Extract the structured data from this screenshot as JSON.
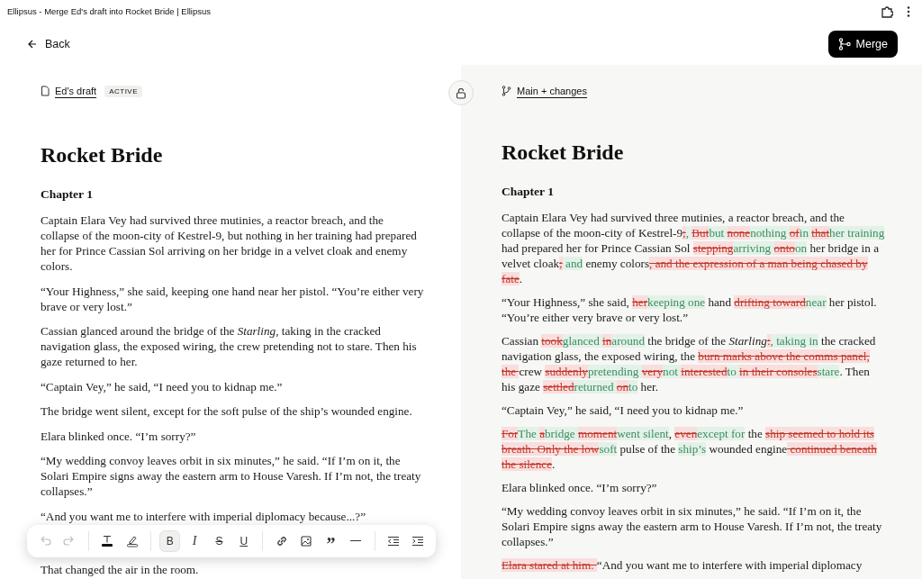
{
  "window": {
    "title": "Ellipsus - Merge Ed's draft into Rocket Bride | Ellipsus"
  },
  "header": {
    "back": "Back",
    "merge": "Merge"
  },
  "left_pane": {
    "doc_link": "Ed's draft",
    "badge": "ACTIVE",
    "title": "Rocket Bride",
    "chapter": "Chapter 1",
    "paragraphs": [
      "Captain Elara Vey had survived three mutinies, a reactor breach, and the collapse of the moon-city of Kestrel-9, but nothing in her training had prepared her for Prince Cassian Sol arriving on her bridge in a velvet cloak and enemy colors.",
      "“Your Highness,” she said, keeping one hand near her pistol. “You’re either very brave or very lost.”",
      "Cassian glanced around the bridge of the *Starling*, taking in the cracked navigation glass, the exposed wiring, the crew pretending not to stare. Then his gaze returned to her.",
      "“Captain Vey,” he said, “I need you to kidnap me.”",
      "The bridge went silent, except for the soft pulse of the ship’s wounded engine.",
      "Elara blinked once. “I’m sorry?”",
      "“My wedding convoy leaves orbit in six minutes,” he said. “If I’m on it, the Solari Empire signs away the eastern arm to House Varesh. If I’m not, the treaty collapses.”",
      "“And you want me to interfere with imperial diplomacy because...?”",
      "That changed the air in the room."
    ]
  },
  "right_pane": {
    "branch_link": "Main + changes",
    "title": "Rocket Bride",
    "chapter": "Chapter 1",
    "paragraphs": [
      [
        {
          "kind": "same",
          "text": "Captain Elara Vey had survived three mutinies, a reactor breach, and the collapse of the moon-city of Kestrel-9"
        },
        {
          "kind": "deleted",
          "text": ";"
        },
        {
          "kind": "inserted",
          "text": ", "
        },
        {
          "kind": "deleted",
          "text": "But"
        },
        {
          "kind": "inserted",
          "text": "but "
        },
        {
          "kind": "deleted",
          "text": "none"
        },
        {
          "kind": "inserted",
          "text": "nothing "
        },
        {
          "kind": "deleted",
          "text": "of"
        },
        {
          "kind": "inserted",
          "text": "in "
        },
        {
          "kind": "deleted",
          "text": "that"
        },
        {
          "kind": "inserted",
          "text": "her training"
        },
        {
          "kind": "same",
          "text": " had prepared her for Prince Cassian Sol "
        },
        {
          "kind": "deleted",
          "text": "stepping"
        },
        {
          "kind": "inserted",
          "text": "arriving "
        },
        {
          "kind": "deleted",
          "text": "onto"
        },
        {
          "kind": "inserted",
          "text": "on"
        },
        {
          "kind": "same",
          "text": " her bridge in a velvet cloak"
        },
        {
          "kind": "deleted",
          "text": ";"
        },
        {
          "kind": "inserted",
          "text": " and"
        },
        {
          "kind": "same",
          "text": " enemy colors"
        },
        {
          "kind": "deleted",
          "text": ", and the expression of a man being chased by fate"
        },
        {
          "kind": "same",
          "text": "."
        }
      ],
      [
        {
          "kind": "same",
          "text": "“Your Highness,” she said, "
        },
        {
          "kind": "deleted",
          "text": "her"
        },
        {
          "kind": "inserted",
          "text": "keeping one"
        },
        {
          "kind": "same",
          "text": " hand "
        },
        {
          "kind": "deleted",
          "text": "drifting toward"
        },
        {
          "kind": "inserted",
          "text": "near"
        },
        {
          "kind": "same",
          "text": " her pistol. “You’re either very brave or very lost.”"
        }
      ],
      [
        {
          "kind": "same",
          "text": "Cassian "
        },
        {
          "kind": "deleted",
          "text": "took"
        },
        {
          "kind": "inserted",
          "text": "glanced "
        },
        {
          "kind": "deleted",
          "text": "in"
        },
        {
          "kind": "inserted",
          "text": "around"
        },
        {
          "kind": "same",
          "text": " the bridge of the *Starling*"
        },
        {
          "kind": "deleted",
          "text": ":"
        },
        {
          "kind": "inserted",
          "text": ", taking in"
        },
        {
          "kind": "same",
          "text": " the cracked navigation glass, the exposed wiring, the "
        },
        {
          "kind": "deleted",
          "text": "burn marks above the comms panel, the "
        },
        {
          "kind": "same",
          "text": "crew "
        },
        {
          "kind": "deleted",
          "text": "suddenly"
        },
        {
          "kind": "inserted",
          "text": "pretending "
        },
        {
          "kind": "deleted",
          "text": "very"
        },
        {
          "kind": "inserted",
          "text": "not "
        },
        {
          "kind": "deleted",
          "text": "interested"
        },
        {
          "kind": "inserted",
          "text": "to "
        },
        {
          "kind": "deleted",
          "text": "in their consoles"
        },
        {
          "kind": "inserted",
          "text": "stare"
        },
        {
          "kind": "same",
          "text": ". Then his gaze "
        },
        {
          "kind": "deleted",
          "text": "settled"
        },
        {
          "kind": "inserted",
          "text": "returned "
        },
        {
          "kind": "deleted",
          "text": "on"
        },
        {
          "kind": "inserted",
          "text": "to"
        },
        {
          "kind": "same",
          "text": " her."
        }
      ],
      [
        {
          "kind": "same",
          "text": "“Captain Vey,” he said, “I need you to kidnap me.”"
        }
      ],
      [
        {
          "kind": "deleted",
          "text": "For"
        },
        {
          "kind": "inserted",
          "text": "The "
        },
        {
          "kind": "deleted",
          "text": "a"
        },
        {
          "kind": "inserted",
          "text": "bridge "
        },
        {
          "kind": "deleted",
          "text": "moment"
        },
        {
          "kind": "inserted",
          "text": "went silent"
        },
        {
          "kind": "same",
          "text": ", "
        },
        {
          "kind": "deleted",
          "text": "even"
        },
        {
          "kind": "inserted",
          "text": "except for"
        },
        {
          "kind": "same",
          "text": " the "
        },
        {
          "kind": "deleted",
          "text": "ship seemed to hold its breath. Only the low"
        },
        {
          "kind": "inserted",
          "text": "soft"
        },
        {
          "kind": "same",
          "text": " pulse of the "
        },
        {
          "kind": "inserted",
          "text": "ship’s"
        },
        {
          "kind": "same",
          "text": " wounded engine"
        },
        {
          "kind": "deleted",
          "text": " continued beneath the silence"
        },
        {
          "kind": "same",
          "text": "."
        }
      ],
      [
        {
          "kind": "same",
          "text": "Elara blinked once. “I’m sorry?”"
        }
      ],
      [
        {
          "kind": "same",
          "text": "“My wedding convoy leaves orbit in six minutes,” he said. “If I’m on it, the Solari Empire signs away the eastern arm to House Varesh. If I’m not, the treaty collapses.”"
        }
      ],
      [
        {
          "kind": "deleted",
          "text": "Elara stared at him. "
        },
        {
          "kind": "same",
          "text": "“And you want me to interfere with imperial diplomacy"
        }
      ]
    ]
  },
  "toolbar": [
    {
      "kind": "undo",
      "disabled": true
    },
    {
      "kind": "redo",
      "disabled": true
    },
    {
      "kind": "divider"
    },
    {
      "kind": "text_color"
    },
    {
      "kind": "highlight"
    },
    {
      "kind": "divider"
    },
    {
      "kind": "bold",
      "label": "B",
      "selected": true
    },
    {
      "kind": "italic",
      "label": "I",
      "selected": false
    },
    {
      "kind": "strike",
      "label": "S",
      "selected": false
    },
    {
      "kind": "underline",
      "label": "U",
      "selected": false
    },
    {
      "kind": "divider"
    },
    {
      "kind": "link"
    },
    {
      "kind": "image"
    },
    {
      "kind": "quote",
      "label": "”"
    },
    {
      "kind": "rule"
    },
    {
      "kind": "divider"
    },
    {
      "kind": "outdent"
    },
    {
      "kind": "indent"
    }
  ]
}
